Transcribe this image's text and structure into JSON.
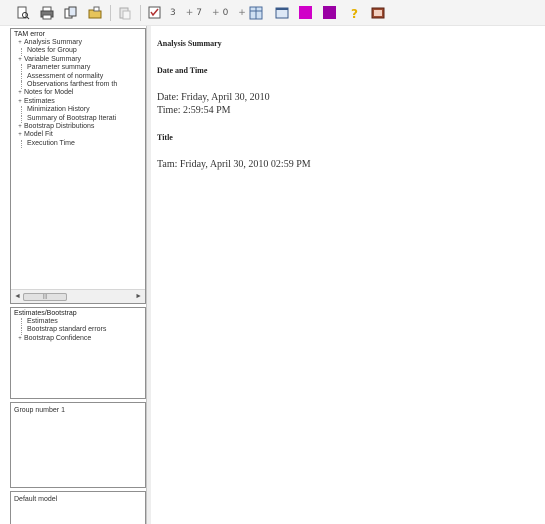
{
  "toolbar": {
    "num1": "3",
    "num2": "7",
    "num3": "0",
    "colors": {
      "magenta": "#d000c8",
      "purple": "#9a00a4",
      "yellow": "#e5b000",
      "accent": "#9a4a30"
    }
  },
  "tree": {
    "title": "TAM error",
    "items": [
      {
        "label": "Analysis Summary",
        "level": 1,
        "expander": "+"
      },
      {
        "label": "Notes for Group",
        "level": 2
      },
      {
        "label": "Variable Summary",
        "level": 1,
        "expander": "+"
      },
      {
        "label": "Parameter summary",
        "level": 2
      },
      {
        "label": "Assessment of normality",
        "level": 2
      },
      {
        "label": "Observations farthest from th",
        "level": 2
      },
      {
        "label": "Notes for Model",
        "level": 1,
        "expander": "+"
      },
      {
        "label": "Estimates",
        "level": 1,
        "expander": "+"
      },
      {
        "label": "Minimization History",
        "level": 2
      },
      {
        "label": "Summary of Bootstrap Iterati",
        "level": 2
      },
      {
        "label": "Bootstrap Distributions",
        "level": 1,
        "expander": "+"
      },
      {
        "label": "Model Fit",
        "level": 1,
        "expander": "+"
      },
      {
        "label": "Execution Time",
        "level": 2
      }
    ]
  },
  "bootstrap_tree": {
    "title": "Estimates/Bootstrap",
    "items": [
      {
        "label": "Estimates",
        "level": 2
      },
      {
        "label": "Bootstrap standard errors",
        "level": 2
      },
      {
        "label": "Bootstrap Confidence",
        "level": 1,
        "expander": "+"
      }
    ]
  },
  "group": {
    "label": "Group number 1"
  },
  "model": {
    "label": "Default model"
  },
  "output": {
    "heading": "Analysis Summary",
    "section1_title": "Date and Time",
    "date_line": "Date: Friday, April 30, 2010",
    "time_line": "Time: 2:59:54 PM",
    "section2_title": "Title",
    "title_line": "Tam: Friday, April 30, 2010 02:59 PM"
  }
}
